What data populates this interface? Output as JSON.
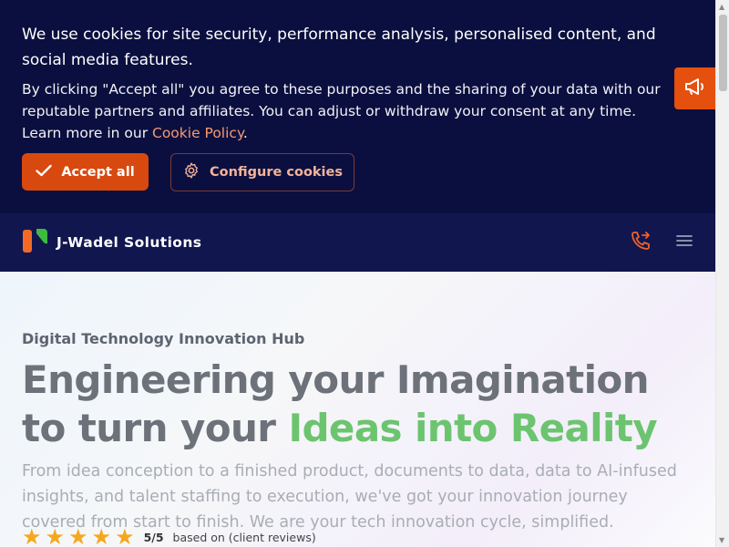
{
  "cookie_banner": {
    "heading": "We use cookies for site security, performance analysis, personalised content, and social media features.",
    "body": "By clicking \"Accept all\" you agree to these purposes and the sharing of your data with our reputable partners and affiliates. You can adjust or withdraw your consent at any time. Learn more in our ",
    "policy_link": "Cookie Policy",
    "policy_suffix": ".",
    "accept_label": "Accept all",
    "configure_label": "Configure cookies"
  },
  "nav": {
    "brand": "J-Wadel Solutions",
    "icons": [
      "phone-forward-icon",
      "menu-icon"
    ]
  },
  "hero": {
    "eyebrow": "Digital Technology Innovation Hub",
    "headline_part1": "Engineering your Imagination to turn your ",
    "headline_highlight": "Ideas into Reality",
    "description": "From idea conception to a finished product, documents to data, data to AI-infused insights, and talent staffing to execution, we've got your innovation journey covered from start to finish. We are your tech innovation cycle, simplified.",
    "rating": {
      "stars": 5,
      "score": "5/5",
      "label": "based on (client reviews)"
    }
  },
  "feedback": {
    "icon": "megaphone-icon"
  },
  "colors": {
    "banner_bg": "#0b0f3f",
    "nav_bg": "#11164f",
    "accent_orange": "#d8490f",
    "highlight_green": "#6cc46f",
    "star": "#f5a81c"
  }
}
